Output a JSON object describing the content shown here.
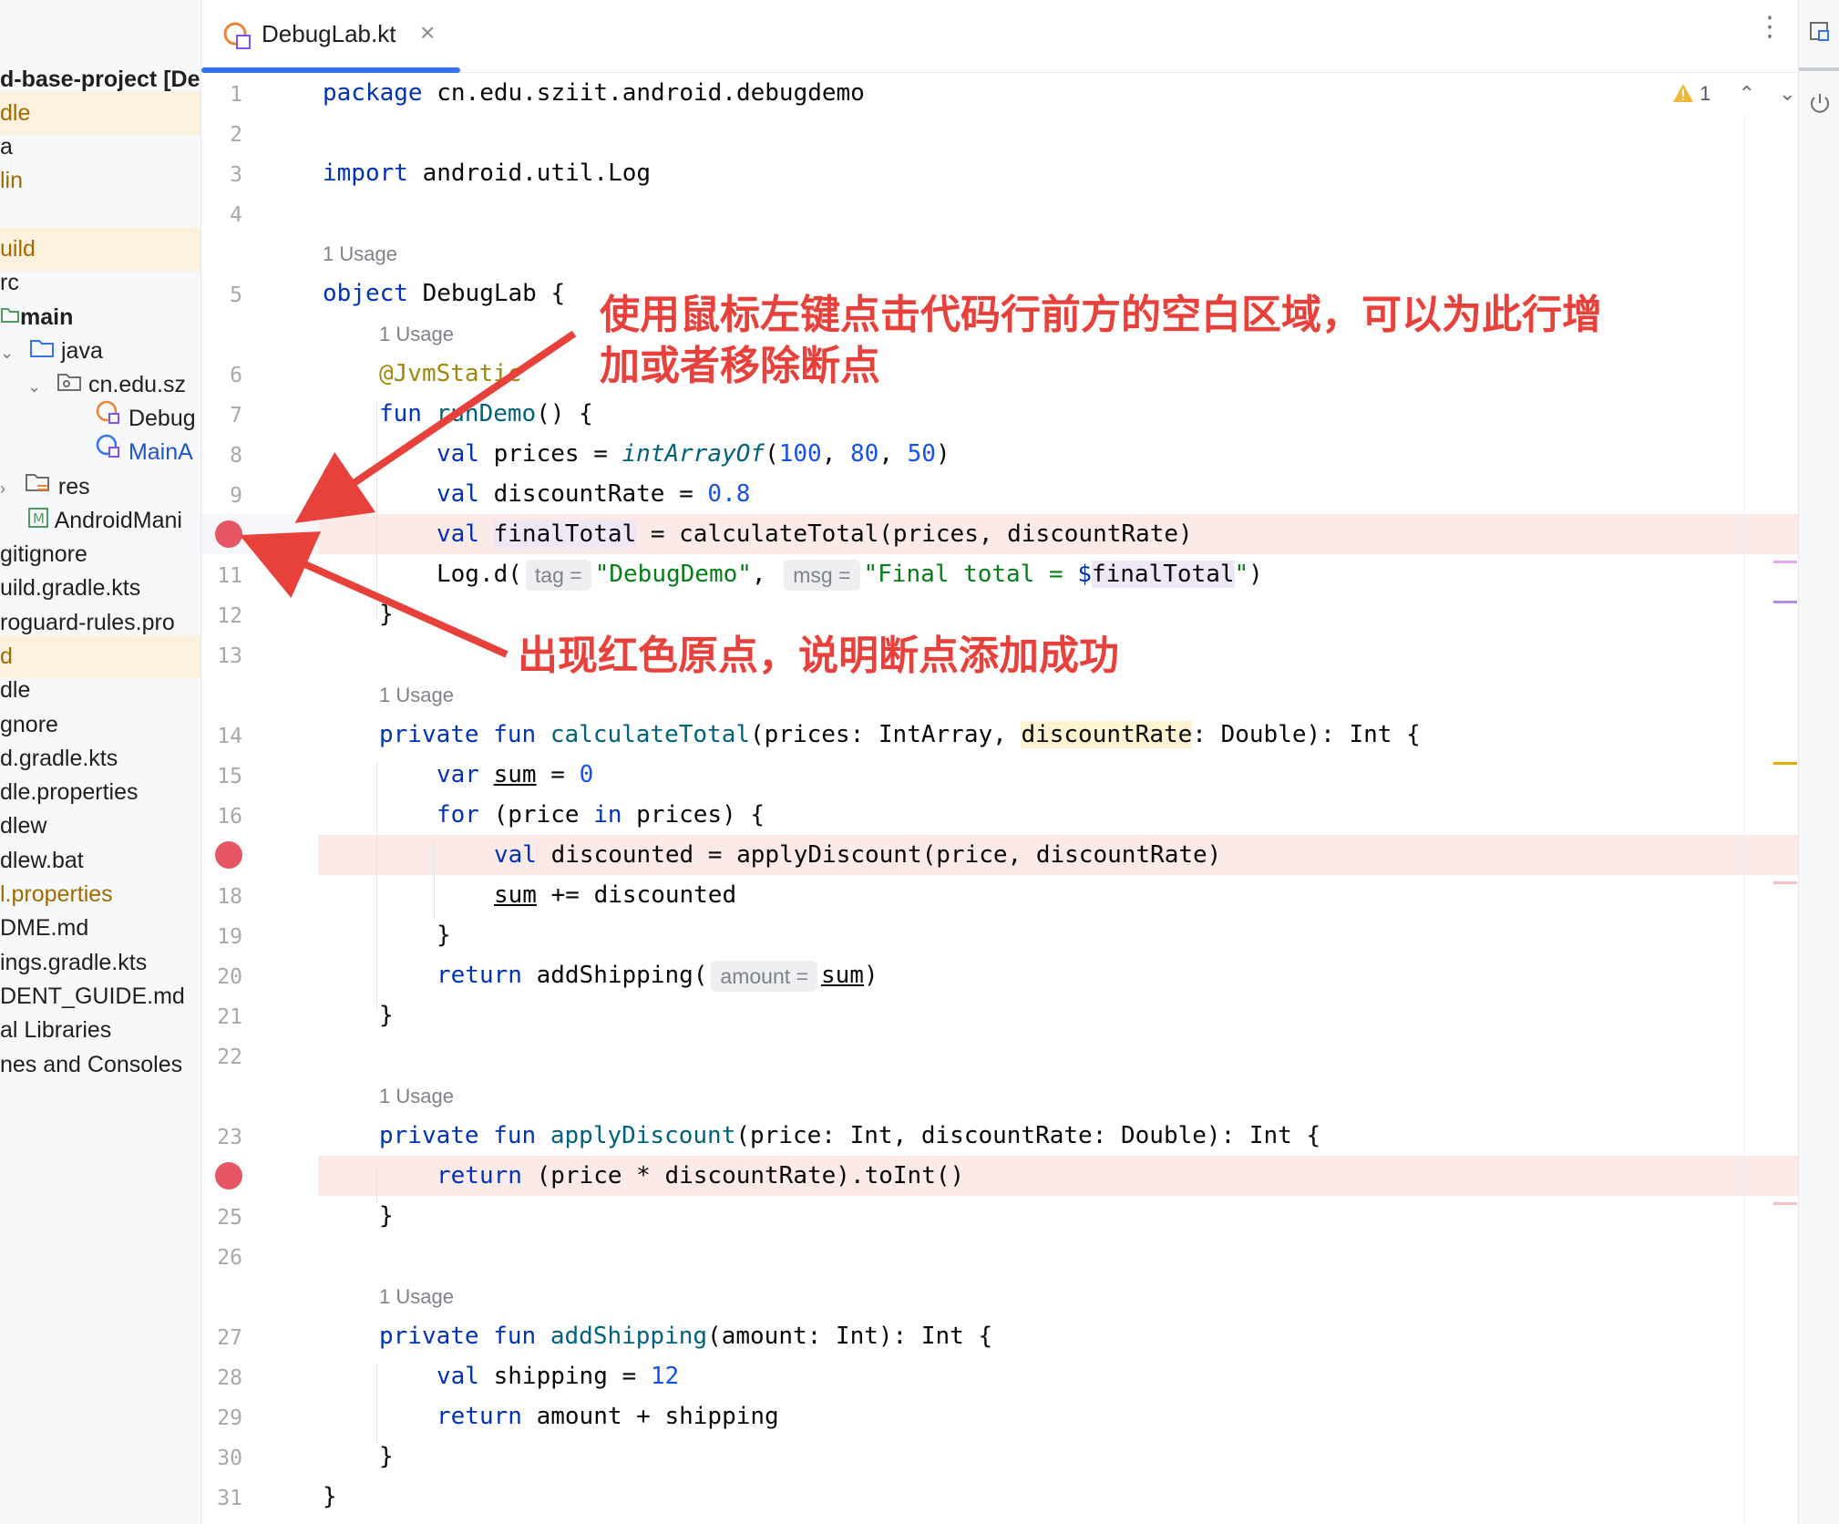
{
  "tab": {
    "title": "DebugLab.kt",
    "close": "×"
  },
  "inspection": {
    "warning_count": "1"
  },
  "tree": [
    {
      "label": "d-base-project [De",
      "style": "bold",
      "hl": false
    },
    {
      "label": "dle",
      "style": "orange",
      "hl": true
    },
    {
      "label": "a",
      "style": "",
      "hl": false
    },
    {
      "label": "lin",
      "style": "orange",
      "hl": false
    },
    {
      "label": "",
      "style": "",
      "hl": false
    },
    {
      "label": "uild",
      "style": "orange",
      "hl": true
    },
    {
      "label": "rc",
      "style": "",
      "hl": false
    },
    {
      "label": "main",
      "style": "bold",
      "hl": false
    },
    {
      "label": "java",
      "style": "",
      "hl": false
    },
    {
      "label": "cn.edu.sz",
      "style": "",
      "hl": false
    },
    {
      "label": "Debug",
      "style": "",
      "hl": false
    },
    {
      "label": "MainA",
      "style": "blue",
      "hl": false
    },
    {
      "label": "res",
      "style": "",
      "hl": false
    },
    {
      "label": "AndroidMani",
      "style": "",
      "hl": false
    },
    {
      "label": "gitignore",
      "style": "",
      "hl": false
    },
    {
      "label": "uild.gradle.kts",
      "style": "",
      "hl": false
    },
    {
      "label": "roguard-rules.pro",
      "style": "",
      "hl": false
    },
    {
      "label": "d",
      "style": "orange",
      "hl": true
    },
    {
      "label": "dle",
      "style": "",
      "hl": false
    },
    {
      "label": "gnore",
      "style": "",
      "hl": false
    },
    {
      "label": "d.gradle.kts",
      "style": "",
      "hl": false
    },
    {
      "label": "dle.properties",
      "style": "",
      "hl": false
    },
    {
      "label": "dlew",
      "style": "",
      "hl": false
    },
    {
      "label": "dlew.bat",
      "style": "",
      "hl": false
    },
    {
      "label": "l.properties",
      "style": "orange",
      "hl": false
    },
    {
      "label": "DME.md",
      "style": "",
      "hl": false
    },
    {
      "label": "ings.gradle.kts",
      "style": "",
      "hl": false
    },
    {
      "label": "DENT_GUIDE.md",
      "style": "",
      "hl": false
    },
    {
      "label": "al Libraries",
      "style": "",
      "hl": false
    },
    {
      "label": "nes and Consoles",
      "style": "",
      "hl": false
    }
  ],
  "gutter": {
    "line_numbers": [
      "1",
      "2",
      "3",
      "4",
      "5",
      "6",
      "7",
      "8",
      "9",
      "11",
      "12",
      "13",
      "14",
      "15",
      "16",
      "18",
      "19",
      "20",
      "21",
      "22",
      "23",
      "25",
      "26",
      "27",
      "28",
      "29",
      "30",
      "31"
    ]
  },
  "usage_label": "1 Usage",
  "code": {
    "l1": [
      "package",
      " cn.edu.sziit.android.debugdemo"
    ],
    "l3": [
      "import",
      " android.util.Log"
    ],
    "l5": [
      "object",
      " DebugLab {"
    ],
    "l6": "@JvmStatic",
    "l7": [
      "fun",
      " runDemo",
      "() {"
    ],
    "l8": [
      "val",
      " prices = ",
      "intArrayOf",
      "(",
      "100",
      ", ",
      "80",
      ", ",
      "50",
      ")"
    ],
    "l9": [
      "val",
      " discountRate = ",
      "0.8"
    ],
    "l10": [
      "val",
      " ",
      "finalTotal",
      " = calculateTotal(prices, discountRate)"
    ],
    "l11": [
      "Log.d(",
      "tag =",
      "\"DebugDemo\"",
      ", ",
      "msg =",
      "\"Final total = ",
      "$",
      "finalTotal",
      "\"",
      ")"
    ],
    "l12": "}",
    "l14": [
      "private",
      " fun",
      " calculateTotal",
      "(prices: IntArray, ",
      "discountRate",
      ": Double): Int {"
    ],
    "l15": [
      "var",
      " ",
      "sum",
      " = ",
      "0"
    ],
    "l16": [
      "for",
      " (price ",
      "in",
      " prices) {"
    ],
    "l17": [
      "val",
      " discounted = applyDiscount(price, discountRate)"
    ],
    "l18": [
      "sum",
      " += discounted"
    ],
    "l19": "}",
    "l20": [
      "return",
      " addShipping(",
      "amount =",
      "sum",
      ")"
    ],
    "l21": "}",
    "l23": [
      "private",
      " fun",
      " applyDiscount",
      "(price: Int, discountRate: Double): Int {"
    ],
    "l24": [
      "return",
      " (price * discountRate).toInt()"
    ],
    "l25": "}",
    "l27": [
      "private",
      " fun",
      " addShipping",
      "(amount: Int): Int {"
    ],
    "l28": [
      "val",
      " shipping = ",
      "12"
    ],
    "l29": [
      "return",
      " amount + shipping"
    ],
    "l30": "}",
    "l31": "}"
  },
  "annotations": {
    "click_hint": "使用鼠标左键点击代码行前方的空白区域，可以为此行增加或者移除断点",
    "click_hint_line1": "使用鼠标左键点击代码行前方的空白区域，可以为此行增",
    "click_hint_line2": "加或者移除断点",
    "success_hint": "出现红色原点，说明断点添加成功"
  },
  "colors": {
    "breakpoint": "#e55765",
    "annotation_red": "#e8403b",
    "breakpoint_row": "#fbeae8",
    "tab_underline": "#3574f0"
  }
}
